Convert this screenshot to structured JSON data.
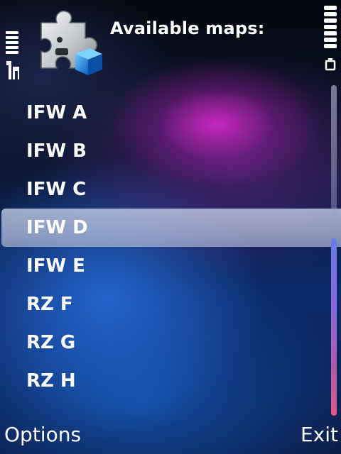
{
  "header": {
    "title": "Available maps:"
  },
  "icons": {
    "signal": "signal-strength-icon",
    "battery": "battery-icon",
    "app": "puzzle-piece-icon"
  },
  "maps": {
    "items": [
      "IFW A",
      "IFW B",
      "IFW C",
      "IFW D",
      "IFW E",
      "RZ F",
      "RZ G",
      "RZ H"
    ],
    "selected_label": "IFW D"
  },
  "softkeys": {
    "left": "Options",
    "right": "Exit"
  },
  "colors": {
    "selection": "#c5cbe0",
    "scrollbar_accent": "#e05a8a",
    "text": "#ffffff"
  }
}
